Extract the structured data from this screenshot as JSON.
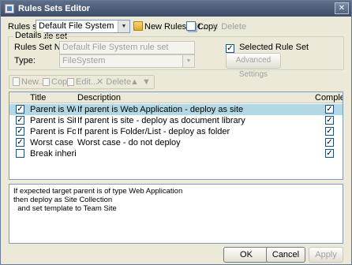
{
  "window": {
    "title": "Rules Sets Editor"
  },
  "rules_set": {
    "label": "Rules set:",
    "selected": "Default File System rule set",
    "new_label": "New Rules set...",
    "copy_label": "Copy",
    "delete_label": "Delete"
  },
  "details": {
    "group_title": "Details",
    "name_label": "Rules Set Name:",
    "name_value": "Default File System rule set",
    "type_label": "Type:",
    "type_value": "FileSystem",
    "selected_rule_set_label": "Selected Rule Set",
    "selected_rule_set_checked": true,
    "advanced_button": "Advanced Settings"
  },
  "toolbar": {
    "new_label": "New...",
    "copy_label": "Copy",
    "edit_label": "Edit...",
    "delete_label": "Delete"
  },
  "grid": {
    "columns": [
      "Title",
      "Description",
      "Complete"
    ],
    "rows": [
      {
        "checked": true,
        "title": "Parent is Web App",
        "description": "If parent is Web Application - deploy as site",
        "complete": true,
        "selected": true
      },
      {
        "checked": true,
        "title": "Parent is Site",
        "description": "If parent is site - deploy as document library",
        "complete": true,
        "selected": false
      },
      {
        "checked": true,
        "title": "Parent is Folder/L...",
        "description": "If parent is Folder/List - deploy as folder",
        "complete": true,
        "selected": false
      },
      {
        "checked": true,
        "title": "Worst case",
        "description": "Worst case - do not deploy",
        "complete": true,
        "selected": false
      },
      {
        "checked": false,
        "title": "Break inheritance",
        "description": "",
        "complete": true,
        "selected": false
      }
    ]
  },
  "description_text": "If expected target parent is of type Web Application\nthen deploy as Site Collection\n  and set template to Team Site",
  "buttons": {
    "ok": "OK",
    "cancel": "Cancel",
    "apply": "Apply"
  }
}
